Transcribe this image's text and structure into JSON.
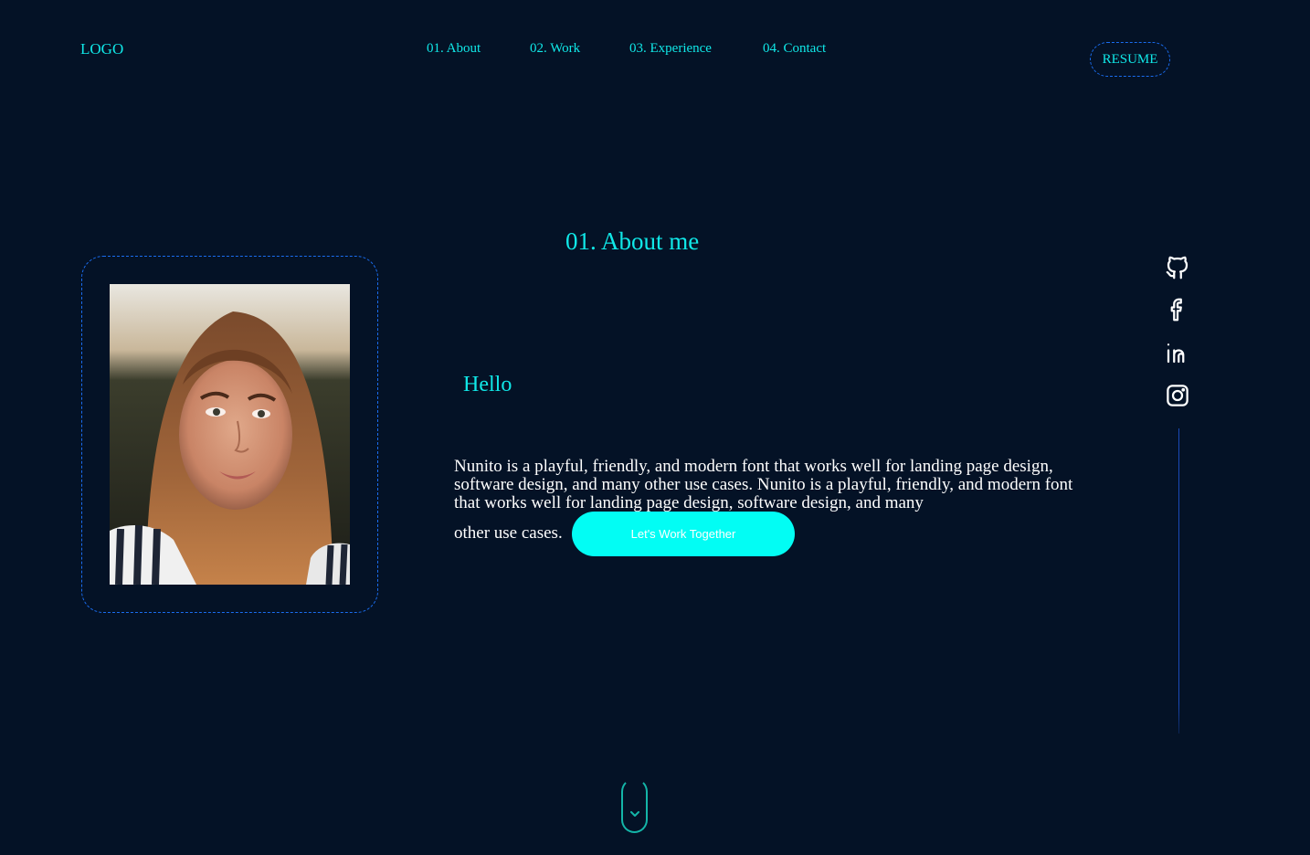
{
  "header": {
    "logo": "LOGO",
    "nav": [
      {
        "label": "01. About"
      },
      {
        "label": "02. Work"
      },
      {
        "label": "03. Experience"
      },
      {
        "label": "04. Contact"
      }
    ],
    "resume_label": "RESUME"
  },
  "about": {
    "title": "01. About me",
    "photo_icon": "portrait-photo",
    "greeting": "Hello",
    "bio": "Nunito is a playful, friendly, and modern font that works well for landing page design, software design, and many other use cases. Nunito is a playful, friendly, and modern font that works well for landing page design, software design, and many",
    "bio_tail": "other use cases.",
    "cta_label": "Let's Work Together"
  },
  "social": [
    {
      "icon": "github-icon"
    },
    {
      "icon": "facebook-icon"
    },
    {
      "icon": "linkedin-icon"
    },
    {
      "icon": "instagram-icon"
    }
  ],
  "scroll": {
    "icon": "chevron-down-icon"
  },
  "colors": {
    "background": "#041226",
    "accent": "#10e8e8",
    "button": "#02fdf4",
    "border": "#1a6df0"
  }
}
